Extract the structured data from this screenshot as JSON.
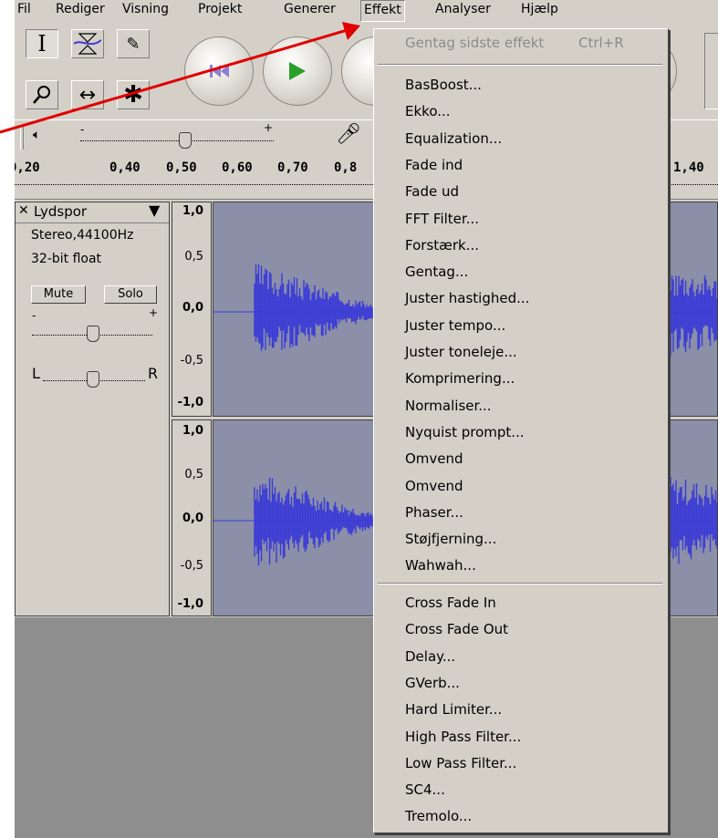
{
  "menubar": {
    "items": [
      "Fil",
      "Rediger",
      "Visning",
      "Projekt",
      "Generer",
      "Effekt",
      "Analyser",
      "Hjælp"
    ],
    "active": "Effekt"
  },
  "meter": {
    "minus": "-",
    "plus": "+"
  },
  "ruler": {
    "ticks": [
      "0,20",
      "0,40",
      "0,50",
      "0,60",
      "0,70",
      "0,8",
      "1,40"
    ]
  },
  "track": {
    "name": "Lydspor",
    "close_glyph": "✕",
    "info_format": "Stereo,44100Hz",
    "info_bits": "32-bit float",
    "mute_label": "Mute",
    "solo_label": "Solo",
    "gain_minus": "-",
    "gain_plus": "+",
    "pan_left": "L",
    "pan_right": "R"
  },
  "vruler": {
    "top": [
      "1,0",
      "0,5",
      "0,0",
      "-0,5",
      "-1,0"
    ],
    "bottom": [
      "1,0",
      "0,5",
      "0,0",
      "-0,5",
      "-1,0"
    ]
  },
  "effekt_menu": {
    "repeat_last": "Gentag sidste effekt",
    "repeat_shortcut": "Ctrl+R",
    "builtin": [
      "BasBoost...",
      "Ekko...",
      "Equalization...",
      "Fade ind",
      "Fade ud",
      "FFT Filter...",
      "Forstærk...",
      "Gentag...",
      "Juster hastighed...",
      "Juster tempo...",
      "Juster toneleje...",
      "Komprimering...",
      "Normaliser...",
      "Nyquist prompt...",
      "Omvend",
      "Omvend",
      "Phaser...",
      "Støjfjerning...",
      "Wahwah..."
    ],
    "plugins": [
      "Cross Fade In",
      "Cross Fade Out",
      "Delay...",
      "GVerb...",
      "Hard Limiter...",
      "High Pass Filter...",
      "Low Pass Filter...",
      "SC4...",
      "Tremolo..."
    ]
  },
  "colors": {
    "waveform": "#3b3bd6",
    "wave_bg": "#8b8fa8",
    "annotation_arrow": "#e00000",
    "play_green": "#2aa02a",
    "rewind_purple": "#8e7fd0"
  },
  "icons": {
    "select_tool": "text-cursor-icon",
    "envelope_tool": "envelope-icon",
    "draw_tool": "pencil-icon",
    "zoom_tool": "magnifier-icon",
    "timeshift_tool": "double-arrow-icon",
    "multi_tool": "asterisk-icon",
    "speaker": "speaker-icon",
    "microphone": "microphone-icon"
  }
}
